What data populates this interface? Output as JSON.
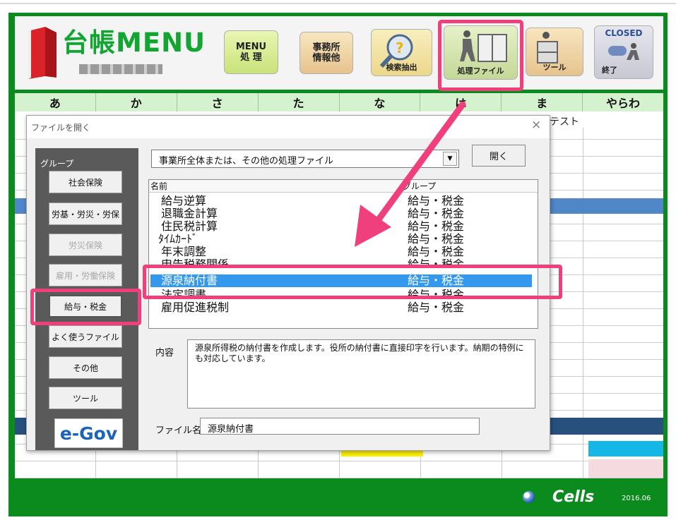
{
  "app": {
    "title": "台帳MENU",
    "brand": "Cells",
    "version": "2016.06"
  },
  "toolbar": {
    "menu_label_line1": "MENU",
    "menu_label_line2": "処 理",
    "office_label_line1": "事務所",
    "office_label_line2": "情報他",
    "search_label": "検索抽出",
    "files_label": "処理ファイル",
    "tool_label": "ツール",
    "closed_label": "CLOSED",
    "exit_label": "終了"
  },
  "tabs": [
    "あ",
    "か",
    "さ",
    "た",
    "な",
    "は",
    "ま",
    "やらわ"
  ],
  "grid": {
    "visible_text": "テスト"
  },
  "dialog": {
    "title": "ファイルを開く",
    "close_glyph": "×",
    "group_label": "グループ",
    "groups": [
      {
        "label": "社会保険",
        "state": "enabled"
      },
      {
        "label": "労基・労災・労保",
        "state": "enabled"
      },
      {
        "label": "労災保険",
        "state": "disabled"
      },
      {
        "label": "雇用・労働保険",
        "state": "disabled"
      },
      {
        "label": "給与・税金",
        "state": "selected"
      },
      {
        "label": "よく使うファイル",
        "state": "enabled"
      },
      {
        "label": "その他",
        "state": "enabled"
      },
      {
        "label": "ツール",
        "state": "enabled"
      }
    ],
    "egov_label": "e-Gov",
    "category_value": "事業所全体または、その他の処理ファイル",
    "open_button": "開く",
    "list_headers": {
      "name": "名前",
      "group": "グループ"
    },
    "files": [
      {
        "name": "給与逆算",
        "group": "給与・税金"
      },
      {
        "name": "退職金計算",
        "group": "給与・税金"
      },
      {
        "name": "住民税計算",
        "group": "給与・税金"
      },
      {
        "name": "ﾀｲﾑｶｰﾄﾞ",
        "group": "給与・税金"
      },
      {
        "name": "年末調整",
        "group": "給与・税金"
      },
      {
        "name": "申告税務関係",
        "group": "給与・税金"
      },
      {
        "name": "源泉納付書",
        "group": "給与・税金",
        "selected": true
      },
      {
        "name": "法定調書",
        "group": "給与・税金"
      },
      {
        "name": "雇用促進税制",
        "group": "給与・税金"
      }
    ],
    "description_label": "内容",
    "description": "源泉所得税の納付書を作成します。役所の納付書に直接印字を行います。納期の特例にも対応しています。",
    "filename_label": "ファイル名",
    "filename_value": "源泉納付書"
  },
  "colors": {
    "frame": "#0b8a1e",
    "highlight": "#ef3f7d",
    "selection": "#3399ee"
  }
}
